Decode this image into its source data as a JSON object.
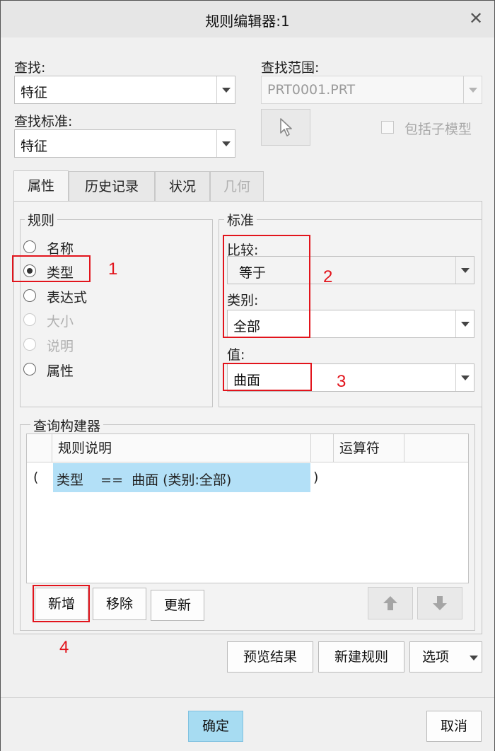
{
  "window": {
    "title": "规则编辑器:1"
  },
  "find": {
    "label": "查找:",
    "value": "特征"
  },
  "scope": {
    "label": "查找范围:",
    "value": "PRT0001.PRT",
    "include_submodels": "包括子模型"
  },
  "criteria": {
    "label": "查找标准:",
    "value": "特征"
  },
  "tabs": [
    {
      "label": "属性",
      "active": true
    },
    {
      "label": "历史记录"
    },
    {
      "label": "状况"
    },
    {
      "label": "几何",
      "disabled": true
    }
  ],
  "rules": {
    "title": "规则",
    "options": [
      {
        "label": "名称"
      },
      {
        "label": "类型",
        "selected": true
      },
      {
        "label": "表达式"
      },
      {
        "label": "大小",
        "disabled": true
      },
      {
        "label": "说明",
        "disabled": true
      },
      {
        "label": "属性"
      }
    ]
  },
  "standard": {
    "title": "标准",
    "compare_label": "比较:",
    "compare_value": "等于",
    "category_label": "类别:",
    "category_value": "全部",
    "value_label": "值:",
    "value_value": "曲面"
  },
  "query_builder": {
    "title": "查询构建器",
    "columns": [
      "规则说明",
      "运算符"
    ],
    "row": {
      "open": "(",
      "description": "类型    ==  曲面 (类别:全部)",
      "close": ")"
    },
    "buttons": {
      "add": "新增",
      "remove": "移除",
      "update": "更新"
    }
  },
  "actions": {
    "preview": "预览结果",
    "new_rule": "新建规则",
    "options": "选项"
  },
  "footer": {
    "ok": "确定",
    "cancel": "取消"
  },
  "annotations": [
    "1",
    "2",
    "3",
    "4"
  ],
  "colors": {
    "annotation_red": "#e2141c",
    "selection_blue": "#b3e0f7",
    "ok_blue": "#a7dcf2"
  }
}
